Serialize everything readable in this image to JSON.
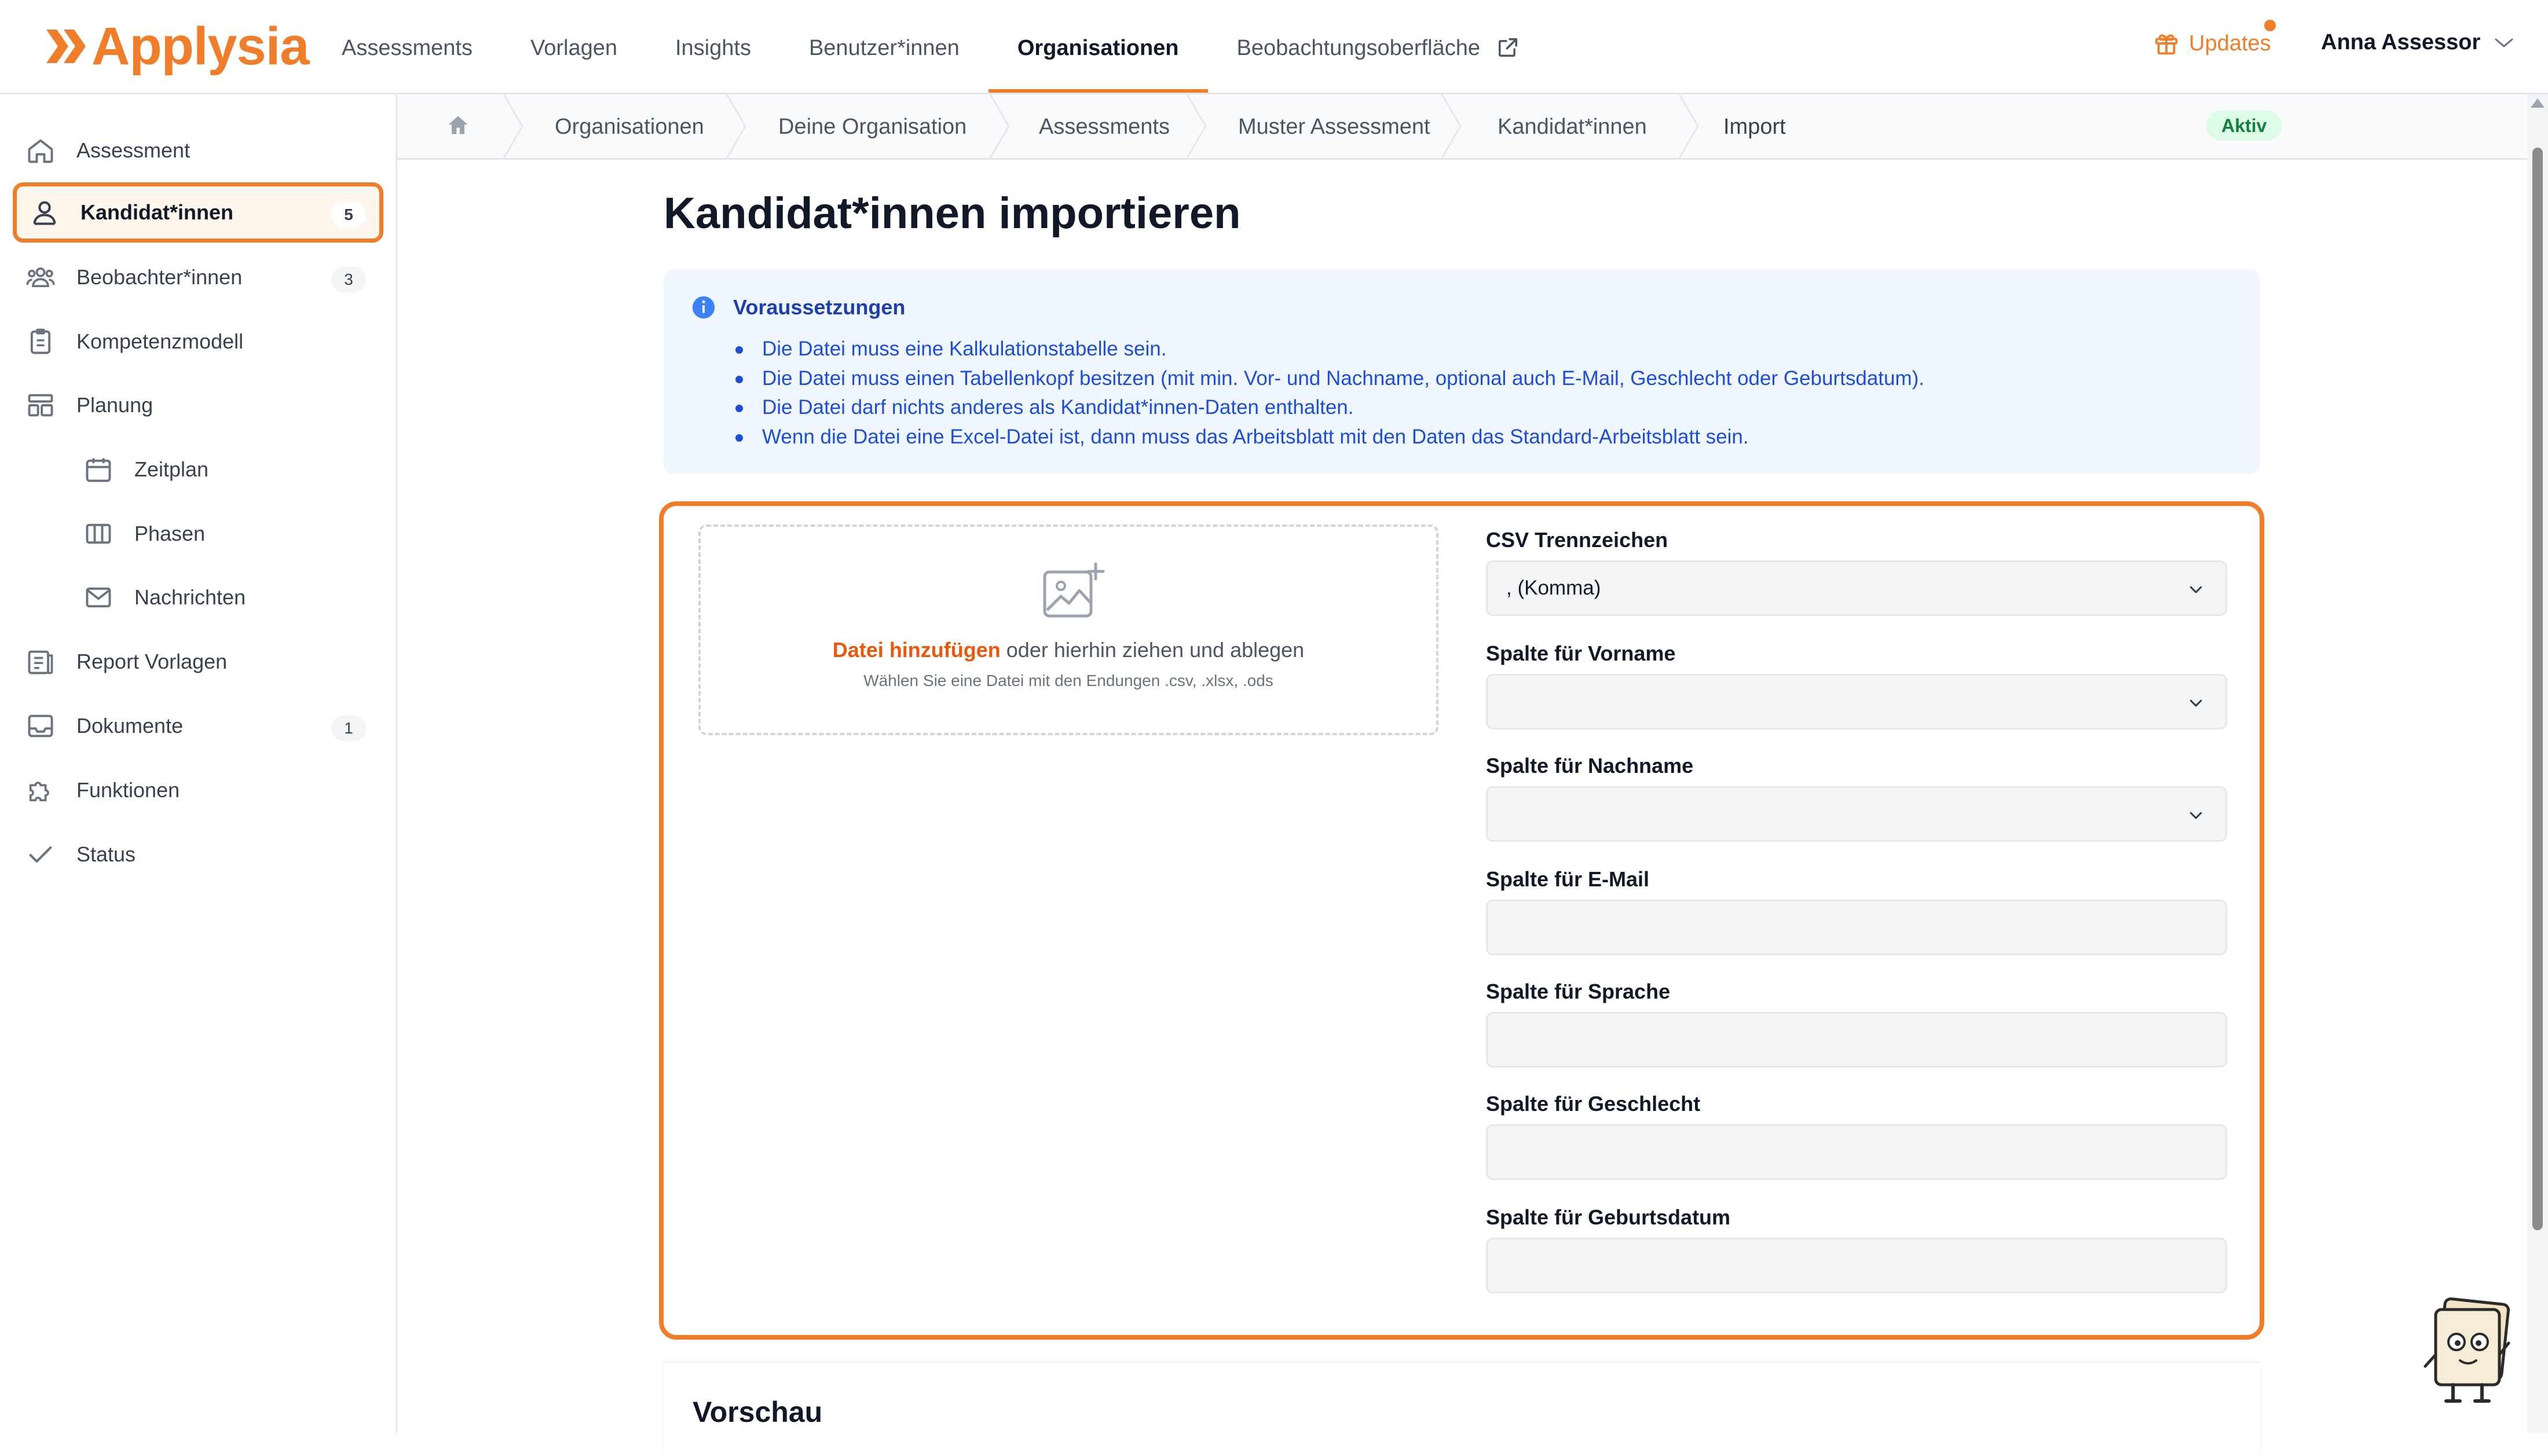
{
  "brand": {
    "name": "Applysia",
    "accent": "#f07d2a"
  },
  "topnav": {
    "items": [
      {
        "label": "Assessments",
        "active": false
      },
      {
        "label": "Vorlagen",
        "active": false
      },
      {
        "label": "Insights",
        "active": false
      },
      {
        "label": "Benutzer*innen",
        "active": false
      },
      {
        "label": "Organisationen",
        "active": true
      },
      {
        "label": "Beobachtungsoberfläche",
        "active": false,
        "icon": "external-link-icon"
      }
    ],
    "updates_label": "Updates",
    "user_name": "Anna Assessor"
  },
  "sidebar": {
    "items": [
      {
        "label": "Assessment",
        "icon": "home-icon"
      },
      {
        "label": "Kandidat*innen",
        "icon": "users-icon",
        "badge": "5",
        "selected": true
      },
      {
        "label": "Beobachter*innen",
        "icon": "group-icon",
        "badge": "3"
      },
      {
        "label": "Kompetenzmodell",
        "icon": "clipboard-icon"
      },
      {
        "label": "Planung",
        "icon": "layout-icon"
      },
      {
        "label": "Zeitplan",
        "icon": "calendar-icon",
        "sub": true
      },
      {
        "label": "Phasen",
        "icon": "columns-icon",
        "sub": true
      },
      {
        "label": "Nachrichten",
        "icon": "mail-icon",
        "sub": true
      },
      {
        "label": "Report Vorlagen",
        "icon": "report-icon"
      },
      {
        "label": "Dokumente",
        "icon": "inbox-icon",
        "badge": "1"
      },
      {
        "label": "Funktionen",
        "icon": "puzzle-icon"
      },
      {
        "label": "Status",
        "icon": "check-icon"
      }
    ]
  },
  "breadcrumb": {
    "items": [
      "Organisationen",
      "Deine Organisation",
      "Assessments",
      "Muster Assessment",
      "Kandidat*innen",
      "Import"
    ],
    "status_badge": "Aktiv"
  },
  "main": {
    "title": "Kandidat*innen importieren",
    "info": {
      "title": "Voraussetzungen",
      "items": [
        "Die Datei muss eine Kalkulationstabelle sein.",
        "Die Datei muss einen Tabellenkopf besitzen (mit min. Vor- und Nachname, optional auch E-Mail, Geschlecht oder Geburtsdatum).",
        "Die Datei darf nichts anderes als Kandidat*innen-Daten enthalten.",
        "Wenn die Datei eine Excel-Datei ist, dann muss das Arbeitsblatt mit den Daten das Standard-Arbeitsblatt sein."
      ]
    },
    "dropzone": {
      "link_text": "Datei hinzufügen",
      "rest_text": " oder hierhin ziehen und ablegen",
      "hint": "Wählen Sie eine Datei mit den Endungen .csv, .xlsx, .ods"
    },
    "fields": {
      "separator": {
        "label": "CSV Trennzeichen",
        "value": ", (Komma)"
      },
      "firstname": {
        "label": "Spalte für Vorname",
        "value": ""
      },
      "lastname": {
        "label": "Spalte für Nachname",
        "value": ""
      },
      "email": {
        "label": "Spalte für E-Mail",
        "value": ""
      },
      "language": {
        "label": "Spalte für Sprache",
        "value": ""
      },
      "gender": {
        "label": "Spalte für Geschlecht",
        "value": ""
      },
      "birthdate": {
        "label": "Spalte für Geburtsdatum",
        "value": ""
      }
    },
    "preview_title": "Vorschau"
  }
}
